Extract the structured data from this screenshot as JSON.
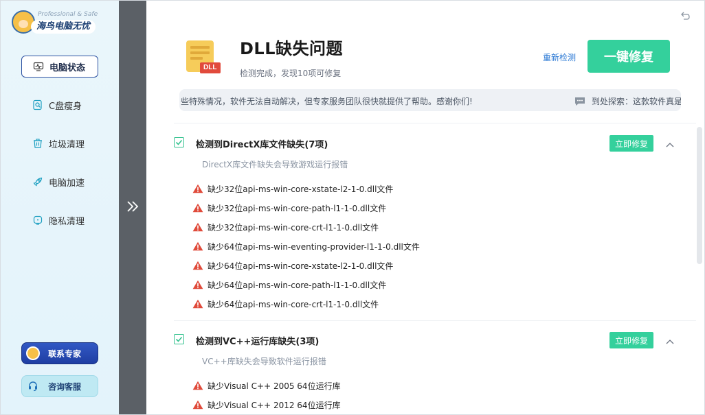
{
  "brand": {
    "tagline": "Professional & Safe",
    "name": "海鸟电脑无忧"
  },
  "sidebar": {
    "items": [
      {
        "label": "电脑状态",
        "icon": "monitor-pulse-icon",
        "active": true
      },
      {
        "label": "C盘瘦身",
        "icon": "disk-search-icon",
        "active": false
      },
      {
        "label": "垃圾清理",
        "icon": "trash-icon",
        "active": false
      },
      {
        "label": "电脑加速",
        "icon": "rocket-icon",
        "active": false
      },
      {
        "label": "隐私清理",
        "icon": "privacy-shield-icon",
        "active": false
      }
    ],
    "expert_button": "联系专家",
    "consult_button": "咨询客服"
  },
  "header": {
    "title": "DLL缺失问题",
    "icon_badge": "DLL",
    "subtitle": "检测完成，发现10项可修复",
    "rescan_label": "重新检测",
    "fix_all_label": "一键修复"
  },
  "notice": {
    "scroll_text": "些特殊情况，软件无法自动解决，但专家服务团队很快就提供了帮助。感谢你们!",
    "chat_text": "到处探索：这款软件真是"
  },
  "sections": [
    {
      "title": "检测到DirectX库文件缺失(7项)",
      "description": "DirectX库文件缺失会导致游戏运行报错",
      "fix_label": "立即修复",
      "checked": true,
      "items": [
        "缺少32位api-ms-win-core-xstate-l2-1-0.dll文件",
        "缺少32位api-ms-win-core-path-l1-1-0.dll文件",
        "缺少32位api-ms-win-core-crt-l1-1-0.dll文件",
        "缺少64位api-ms-win-eventing-provider-l1-1-0.dll文件",
        "缺少64位api-ms-win-core-xstate-l2-1-0.dll文件",
        "缺少64位api-ms-win-core-path-l1-1-0.dll文件",
        "缺少64位api-ms-win-core-crt-l1-1-0.dll文件"
      ]
    },
    {
      "title": "检测到VC++运行库缺失(3项)",
      "description": "VC++库缺失会导致软件运行报错",
      "fix_label": "立即修复",
      "checked": true,
      "items": [
        "缺少Visual C++ 2005 64位运行库",
        "缺少Visual C++ 2012 64位运行库"
      ]
    }
  ],
  "colors": {
    "accent_green": "#34d09c",
    "link_blue": "#2a78d4",
    "warn_red": "#e04a3a",
    "nav_border": "#2a4fa0"
  }
}
